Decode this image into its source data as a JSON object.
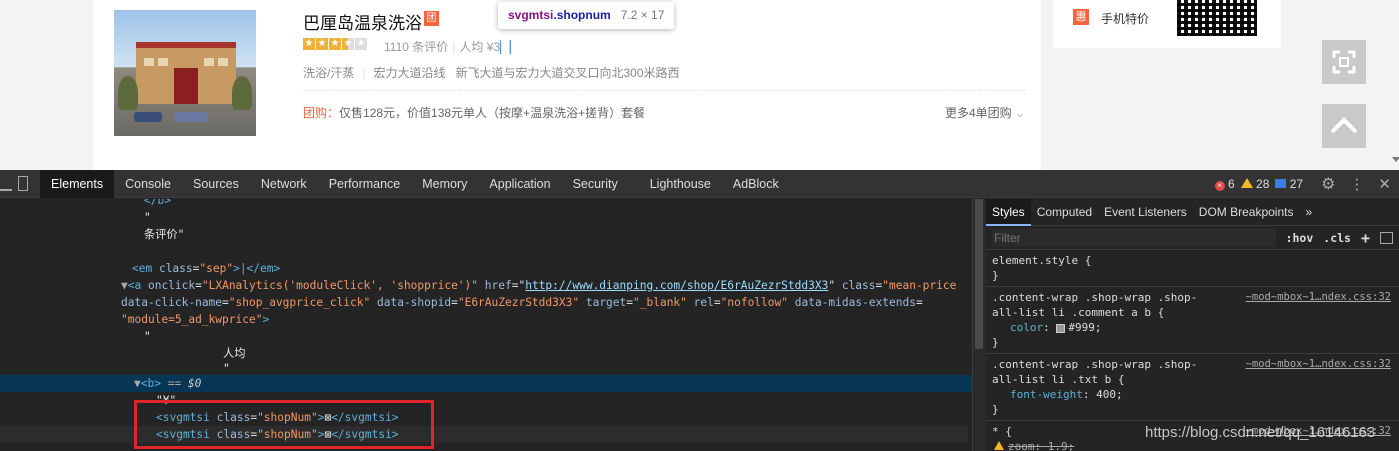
{
  "listing": {
    "title": "巴厘岛温泉洗浴",
    "tuan_badge": "团",
    "rating_stars": 3.5,
    "review_count": "1110",
    "review_label": "条评价",
    "sep": "|",
    "avg_label": "人均",
    "price_prefix": "¥",
    "price_visible": "3",
    "price_highlight": "█",
    "category": "洗浴/汗蒸",
    "area": "宏力大道沿线",
    "address": "新飞大道与宏力大道交叉口向北300米路西",
    "deal_label": "团购：",
    "deal_text": "仅售128元，价值138元单人（按摩+温泉洗浴+搓背）套餐",
    "more_deals": "更多4单团购"
  },
  "tooltip": {
    "tag": "svgmtsi",
    "cls": ".shopnum",
    "dims": "7.2 × 17"
  },
  "side_panel": {
    "badge": "惠",
    "label": "手机特价"
  },
  "devtools": {
    "tabs": [
      "Elements",
      "Console",
      "Sources",
      "Network",
      "Performance",
      "Memory",
      "Application",
      "Security",
      "Lighthouse",
      "AdBlock"
    ],
    "active_tab": "Elements",
    "errors": "6",
    "warnings": "28",
    "infos": "27",
    "code": {
      "l1_tag": "</b>",
      "l2_text": "\"",
      "l3_text": "条评价\"",
      "l4_open": "<em ",
      "l4_attr": "class",
      "l4_val": "\"sep\"",
      "l4_mid": ">|</em>",
      "l5_open": "<a ",
      "l5_a1": "onclick",
      "l5_v1": "\"LXAnalytics('moduleClick', 'shopprice')\"",
      "l5_a2": "href",
      "l5_url": "http://www.dianping.com/shop/E6rAuZezrStdd3X3",
      "l5_a3": "class",
      "l5_v3": "\"mean-price",
      "l6_a1": "data-click-name",
      "l6_v1": "\"shop_avgprice_click\"",
      "l6_a2": "data-shopid",
      "l6_v2": "\"E6rAuZezrStdd3X3\"",
      "l6_a3": "target",
      "l6_v3": "\"_blank\"",
      "l6_a4": "rel",
      "l6_v4": "\"nofollow\"",
      "l6_a5": "data-midas-extends",
      "l7_v": "\"module=5_ad_kwprice\"",
      "l7_end": ">",
      "l8_text": "\"",
      "l9_text": "人均",
      "l10_text": "\"",
      "l11_tag": "<b>",
      "l11_eq": " == ",
      "l11_var": "$0",
      "l12_text": "\"¥\"",
      "l13_open": "<svgmtsi ",
      "l13_attr": "class",
      "l13_val": "\"shopNum\"",
      "l13_glyph": "⊠",
      "l13_close": "</svgmtsi>"
    },
    "styles": {
      "tabs": [
        "Styles",
        "Computed",
        "Event Listeners",
        "DOM Breakpoints"
      ],
      "active_tab": "Styles",
      "more": "»",
      "filter_placeholder": "Filter",
      "hov": ":hov",
      "cls": ".cls",
      "plus": "+",
      "element_style": "element.style {",
      "close_brace": "}",
      "rule1_sel1": ".content-wrap .shop-wrap .shop-",
      "rule1_sel2": "all-list li .comment a b {",
      "rule1_src": "~mod~mbox~1…ndex.css:32",
      "rule1_prop": "color",
      "rule1_val": "#999;",
      "rule2_sel1": ".content-wrap .shop-wrap .shop-",
      "rule2_sel2": "all-list li .txt b {",
      "rule2_src": "~mod~mbox~1…ndex.css:32",
      "rule2_prop": "font-weight",
      "rule2_val": "400;",
      "rule3_sel": "* {",
      "rule3_src": "~mod~mbox~1…ndex.css:32",
      "rule3_prop": "zoom",
      "rule3_val": "1.9;"
    }
  },
  "watermark": "https://blog.csdn.net/qq_16146163"
}
